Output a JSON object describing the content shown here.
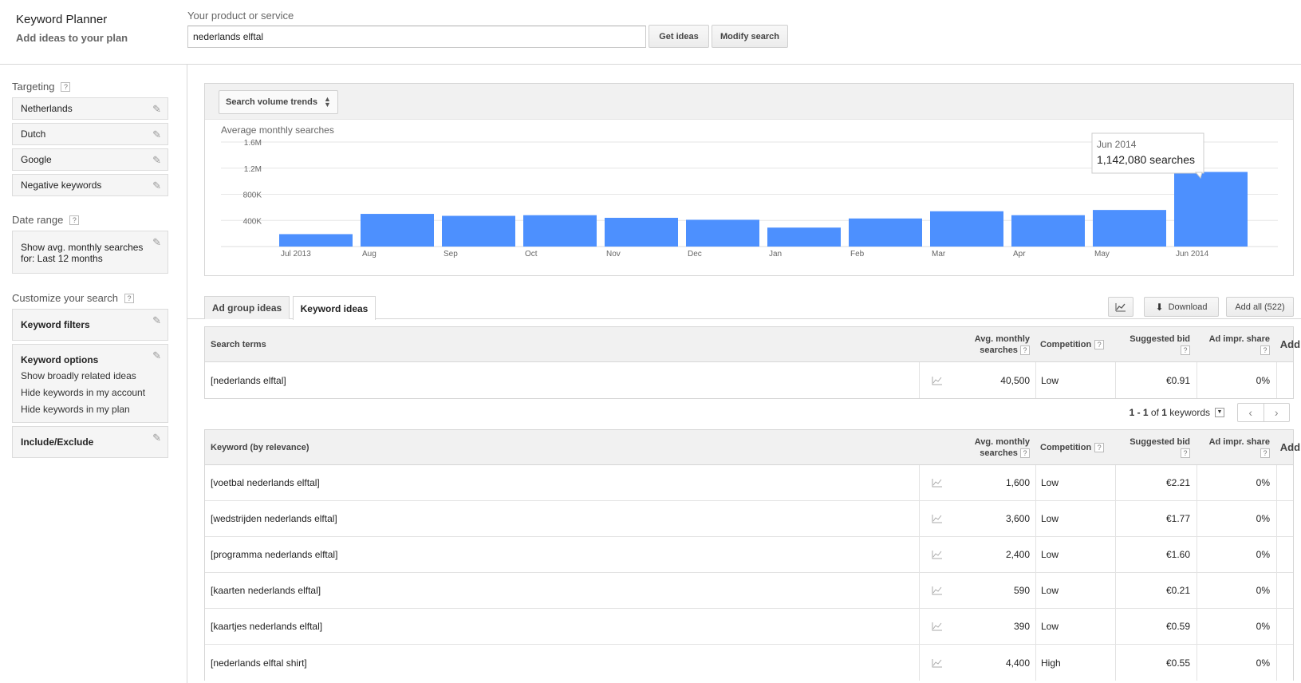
{
  "header": {
    "app_title": "Keyword Planner",
    "app_subtitle": "Add ideas to your plan",
    "product_label": "Your product or service",
    "product_value": "nederlands elftal",
    "get_ideas": "Get ideas",
    "modify_search": "Modify search"
  },
  "sidebar": {
    "targeting_title": "Targeting",
    "targeting_items": [
      "Netherlands",
      "Dutch",
      "Google",
      "Negative keywords"
    ],
    "date_range_title": "Date range",
    "date_range_line1": "Show avg. monthly searches",
    "date_range_line2": "for: Last 12 months",
    "customize_title": "Customize your search",
    "keyword_filters": "Keyword filters",
    "keyword_options": "Keyword options",
    "keyword_options_items": [
      "Show broadly related ideas",
      "Hide keywords in my account",
      "Hide keywords in my plan"
    ],
    "include_exclude": "Include/Exclude",
    "help": "?",
    "edit_icon": "pencil-icon"
  },
  "chart_panel": {
    "selector_label": "Search volume trends"
  },
  "chart_data": {
    "type": "bar",
    "title": "Average monthly searches",
    "xlabel": "",
    "ylabel": "",
    "categories": [
      "Jul 2013",
      "Aug",
      "Sep",
      "Oct",
      "Nov",
      "Dec",
      "Jan",
      "Feb",
      "Mar",
      "Apr",
      "May",
      "Jun 2014"
    ],
    "values": [
      190000,
      500000,
      470000,
      480000,
      440000,
      410000,
      290000,
      430000,
      540000,
      480000,
      560000,
      1142080
    ],
    "yticks": [
      "400K",
      "800K",
      "1.2M",
      "1.6M"
    ],
    "ytick_values": [
      400000,
      800000,
      1200000,
      1600000
    ],
    "ylim": [
      0,
      1600000
    ],
    "bar_color": "#4d90fe",
    "grid": true,
    "tooltip": {
      "category": "Jun 2014",
      "value_text": "1,142,080 searches"
    }
  },
  "tabs": [
    {
      "label": "Ad group ideas",
      "active": false
    },
    {
      "label": "Keyword ideas",
      "active": true
    }
  ],
  "tools": {
    "chart_icon": "line-chart-icon",
    "download": "Download",
    "add_all": "Add all (522)"
  },
  "table_headers": {
    "search_terms": "Search terms",
    "keyword_relevance": "Keyword (by relevance)",
    "avg_monthly_line1": "Avg. monthly",
    "avg_monthly_line2": "searches",
    "competition": "Competition",
    "suggested_bid": "Suggested bid",
    "ad_impr_share": "Ad impr. share",
    "add_to_plan": "Add to plan",
    "help": "?"
  },
  "search_terms_rows": [
    {
      "term": "[nederlands elftal]",
      "avg": "40,500",
      "competition": "Low",
      "bid": "€0.91",
      "share": "0%"
    }
  ],
  "pager": {
    "range": "1 - 1",
    "of": " of ",
    "total": "1",
    "unit": " keywords"
  },
  "keyword_rows": [
    {
      "term": "[voetbal nederlands elftal]",
      "avg": "1,600",
      "competition": "Low",
      "bid": "€2.21",
      "share": "0%"
    },
    {
      "term": "[wedstrijden nederlands elftal]",
      "avg": "3,600",
      "competition": "Low",
      "bid": "€1.77",
      "share": "0%"
    },
    {
      "term": "[programma nederlands elftal]",
      "avg": "2,400",
      "competition": "Low",
      "bid": "€1.60",
      "share": "0%"
    },
    {
      "term": "[kaarten nederlands elftal]",
      "avg": "590",
      "competition": "Low",
      "bid": "€0.21",
      "share": "0%"
    },
    {
      "term": "[kaartjes nederlands elftal]",
      "avg": "390",
      "competition": "Low",
      "bid": "€0.59",
      "share": "0%"
    },
    {
      "term": "[nederlands elftal shirt]",
      "avg": "4,400",
      "competition": "High",
      "bid": "€0.55",
      "share": "0%"
    }
  ],
  "add_to_plan_glyph": "[ » ]",
  "trend_glyph": "📈"
}
